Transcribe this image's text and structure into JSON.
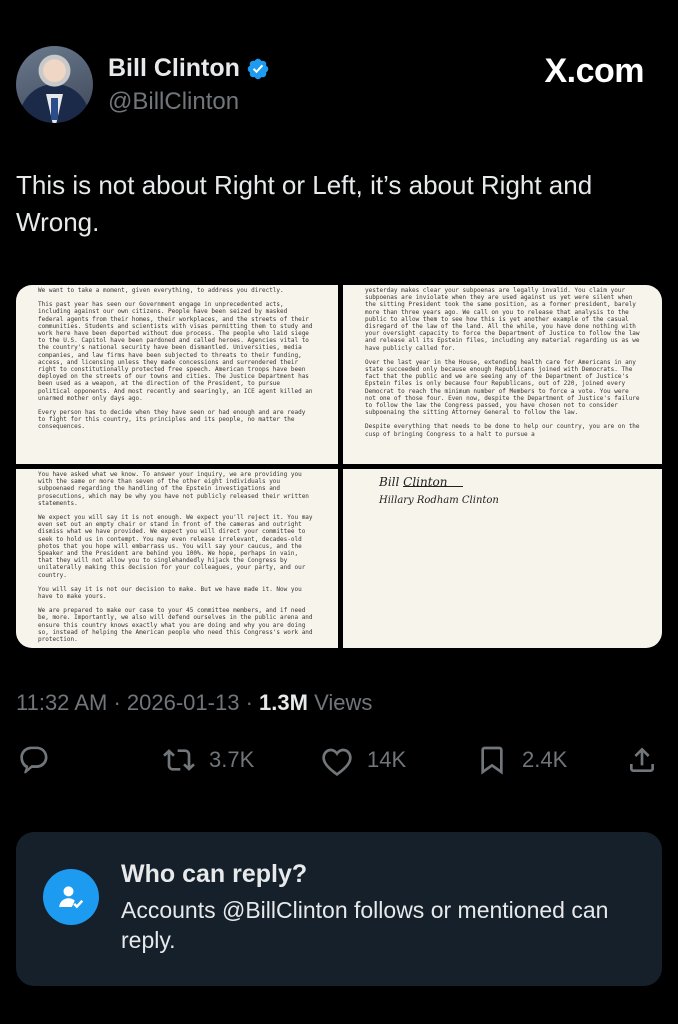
{
  "author": {
    "name": "Bill Clinton",
    "handle": "@BillClinton"
  },
  "brand": "X.com",
  "tweet": {
    "text": "This is not about Right or Left, it’s about Right and Wrong.",
    "time": "11:32 AM",
    "date": "2026-01-13",
    "views_count": "1.3M",
    "views_label": "Views",
    "sep": "·"
  },
  "letter": {
    "page1": [
      "We want to take a moment, given everything, to address you directly.",
      "This past year has seen our Government engage in unprecedented acts, including against our own citizens. People have been seized by masked federal agents from their homes, their workplaces, and the streets of their communities. Students and scientists with visas permitting them to study and work here have been deported without due process. The people who laid siege to the U.S. Capitol have been pardoned and called heroes. Agencies vital to the country's national security have been dismantled. Universities, media companies, and law firms have been subjected to threats to their funding, access, and licensing unless they made concessions and surrendered their right to constitutionally protected free speech. American troops have been deployed on the streets of our towns and cities. The Justice Department has been used as a weapon, at the direction of the President, to pursue political opponents. And most recently and searingly, an ICE agent killed an unarmed mother only days ago.",
      "Every person has to decide when they have seen or had enough and are ready to fight for this country, its principles and its people, no matter the consequences."
    ],
    "page2": [
      "yesterday makes clear your subpoenas are legally invalid. You claim your subpoenas are inviolate when they are used against us yet were silent when the sitting President took the same position, as a former president, barely more than three years ago. We call on you to release that analysis to the public to allow them to see how this is yet another example of the casual disregard of the law of the land. All the while, you have done nothing with your oversight capacity to force the Department of Justice to follow the law and release all its Epstein files, including any material regarding us as we have publicly called for.",
      "Over the last year in the House, extending health care for Americans in any state succeeded only because enough Republicans joined with Democrats. The fact that the public and we are seeing any of the Department of Justice's Epstein files is only because four Republicans, out of 220, joined every Democrat to reach the minimum number of Members to force a vote. You were not one of those four. Even now, despite the Department of Justice's failure to follow the law the Congress passed, you have chosen not to consider subpoenaing the sitting Attorney General to follow the law.",
      "Despite everything that needs to be done to help our country, you are on the cusp of bringing Congress to a halt to pursue a"
    ],
    "page3": [
      "You have asked what we know. To answer your inquiry, we are providing you with the same or more than seven of the other eight individuals you subpoenaed regarding the handling of the Epstein investigations and prosecutions, which may be why you have not publicly released their written statements.",
      "We expect you will say it is not enough. We expect you'll reject it. You may even set out an empty chair or stand in front of the cameras and outright dismiss what we have provided. We expect you will direct your committee to seek to hold us in contempt. You may even release irrelevant, decades-old photos that you hope will embarrass us. You will say your caucus, and the Speaker and the President are behind you 100%. We hope, perhaps in vain, that they will not allow you to singlehandedly hijack the Congress by unilaterally making this decision for your colleagues, your party, and our country.",
      "You will say it is not our decision to make. But we have made it. Now you have to make yours.",
      "We are prepared to make our case to your 45 committee members, and if need be, more. Importantly, we also will defend ourselves in the public arena and ensure this country knows exactly what you are doing and why you are doing so, instead of helping the American people who need this Congress's work and protection."
    ],
    "signature1": "Bill Clinton",
    "signature2": "Hillary Rodham Clinton"
  },
  "actions": {
    "retweets": "3.7K",
    "likes": "14K",
    "bookmarks": "2.4K"
  },
  "reply_settings": {
    "title": "Who can reply?",
    "description": "Accounts @BillClinton follows or mentioned can reply."
  },
  "colors": {
    "background": "#000000",
    "text": "#e7e9ea",
    "muted": "#71767b",
    "accent": "#1d9bf0",
    "card": "#16202a"
  },
  "icons": [
    "verified-badge-icon",
    "reply-icon",
    "retweet-icon",
    "like-icon",
    "bookmark-icon",
    "share-icon",
    "reply-settings-icon"
  ]
}
